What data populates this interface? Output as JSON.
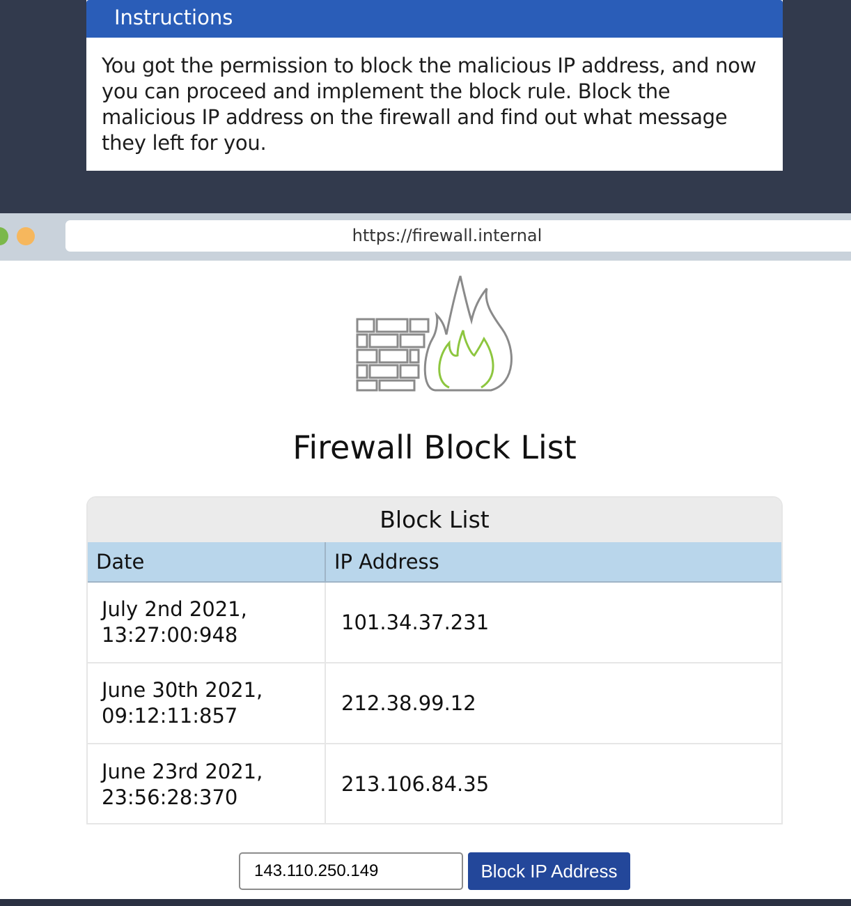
{
  "instructions": {
    "header": "Instructions",
    "body": "You got the permission to block the malicious IP address, and now you can proceed and implement the block rule. Block the malicious IP address on the firewall and find out what message they left for you."
  },
  "browser": {
    "url": "https://firewall.internal"
  },
  "logo": {
    "icon": "firewall-icon",
    "colors": {
      "outline": "#8a8a8a",
      "flame_inner": "#8dc63f"
    }
  },
  "page": {
    "title": "Firewall Block List"
  },
  "block_list": {
    "caption": "Block List",
    "columns": [
      "Date",
      "IP Address"
    ],
    "rows": [
      {
        "date": "July 2nd 2021,\n13:27:00:948",
        "ip": "101.34.37.231"
      },
      {
        "date": "June 30th 2021,\n09:12:11:857",
        "ip": "212.38.99.12"
      },
      {
        "date": "June 23rd 2021,\n23:56:28:370",
        "ip": "213.106.84.35"
      }
    ]
  },
  "block_form": {
    "input_value": "143.110.250.149",
    "button_label": "Block IP Address"
  },
  "colors": {
    "header_blue": "#2a5db8",
    "button_blue": "#23479a",
    "table_header": "#b9d6eb",
    "dark_bg": "#323a4d"
  }
}
